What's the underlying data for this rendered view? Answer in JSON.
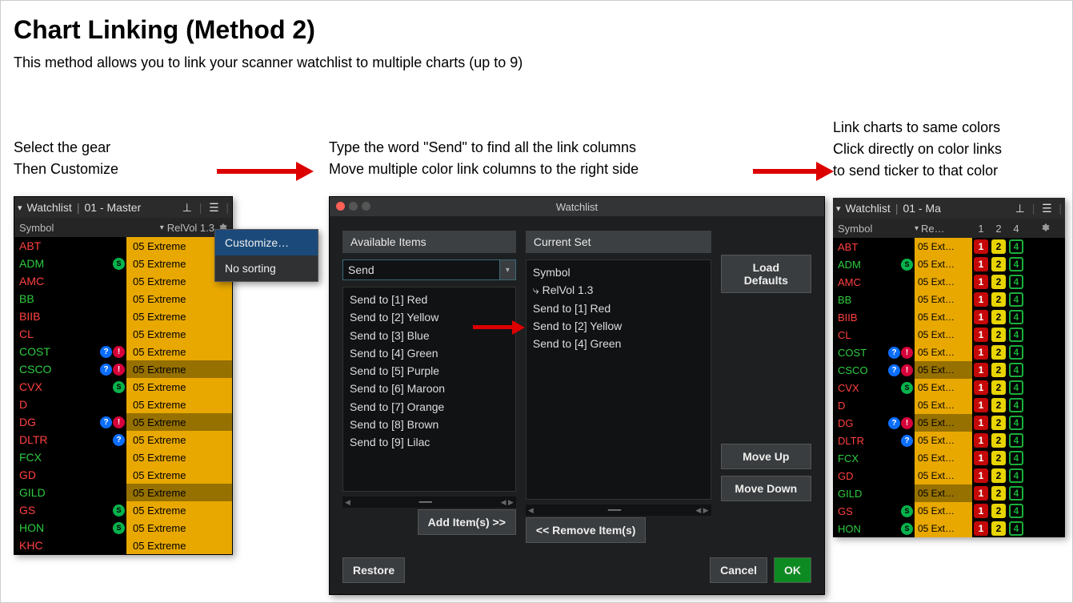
{
  "title": "Chart Linking (Method 2)",
  "subtitle": "This method allows you to link your scanner watchlist to multiple charts (up to 9)",
  "step1": {
    "caption1": "Select the gear",
    "caption2": "Then Customize",
    "titlebar_label": "Watchlist",
    "titlebar_profile": "01 - Master",
    "header_symbol": "Symbol",
    "header_relvol": "RelVol 1.3",
    "ctx_customize": "Customize…",
    "ctx_nosorting": "No sorting",
    "rows": [
      {
        "sym": "ABT",
        "c": "red",
        "vol": "05 Extreme",
        "b": true,
        "icons": []
      },
      {
        "sym": "ADM",
        "c": "green",
        "vol": "05 Extreme",
        "b": true,
        "icons": [
          "s"
        ]
      },
      {
        "sym": "AMC",
        "c": "red",
        "vol": "05 Extreme",
        "b": true,
        "icons": []
      },
      {
        "sym": "BB",
        "c": "green",
        "vol": "05 Extreme",
        "b": true,
        "icons": []
      },
      {
        "sym": "BIIB",
        "c": "red",
        "vol": "05 Extreme",
        "b": true,
        "icons": []
      },
      {
        "sym": "CL",
        "c": "red",
        "vol": "05 Extreme",
        "b": true,
        "icons": []
      },
      {
        "sym": "COST",
        "c": "green",
        "vol": "05 Extreme",
        "b": true,
        "icons": [
          "q",
          "bang"
        ]
      },
      {
        "sym": "CSCO",
        "c": "green",
        "vol": "05 Extreme",
        "b": false,
        "icons": [
          "q",
          "bang"
        ]
      },
      {
        "sym": "CVX",
        "c": "red",
        "vol": "05 Extreme",
        "b": true,
        "icons": [
          "s"
        ]
      },
      {
        "sym": "D",
        "c": "red",
        "vol": "05 Extreme",
        "b": true,
        "icons": []
      },
      {
        "sym": "DG",
        "c": "red",
        "vol": "05 Extreme",
        "b": false,
        "icons": [
          "q",
          "bang"
        ]
      },
      {
        "sym": "DLTR",
        "c": "red",
        "vol": "05 Extreme",
        "b": true,
        "icons": [
          "q"
        ]
      },
      {
        "sym": "FCX",
        "c": "green",
        "vol": "05 Extreme",
        "b": true,
        "icons": []
      },
      {
        "sym": "GD",
        "c": "red",
        "vol": "05 Extreme",
        "b": true,
        "icons": []
      },
      {
        "sym": "GILD",
        "c": "green",
        "vol": "05 Extreme",
        "b": false,
        "icons": []
      },
      {
        "sym": "GS",
        "c": "red",
        "vol": "05 Extreme",
        "b": true,
        "icons": [
          "s"
        ]
      },
      {
        "sym": "HON",
        "c": "green",
        "vol": "05 Extreme",
        "b": true,
        "icons": [
          "s"
        ]
      },
      {
        "sym": "KHC",
        "c": "red",
        "vol": "05 Extreme",
        "b": true,
        "icons": []
      }
    ]
  },
  "step2": {
    "caption1": "Type the word \"Send\" to find all the link columns",
    "caption2": "Move multiple color link columns to the right side",
    "dialog_title": "Watchlist",
    "available_title": "Available Items",
    "current_title": "Current Set",
    "search_value": "Send",
    "available": [
      "Send to [1] Red",
      "Send to [2] Yellow",
      "Send to [3] Blue",
      "Send to [4] Green",
      "Send to [5] Purple",
      "Send to [6] Maroon",
      "Send to [7] Orange",
      "Send to [8] Brown",
      "Send to [9] Lilac"
    ],
    "current": [
      "Symbol",
      "⤷ RelVol 1.3",
      "Send to [1] Red",
      "Send to [2] Yellow",
      "Send to [4] Green"
    ],
    "btn_load_defaults": "Load Defaults",
    "btn_move_up": "Move Up",
    "btn_move_down": "Move Down",
    "btn_add": "Add Item(s) >>",
    "btn_remove": "<< Remove Item(s)",
    "btn_restore": "Restore",
    "btn_cancel": "Cancel",
    "btn_ok": "OK"
  },
  "step3": {
    "caption1": "Link charts to same colors",
    "caption2": "Click directly on color links",
    "caption3": "to send ticker to that color",
    "titlebar_label": "Watchlist",
    "titlebar_profile": "01 - Ma",
    "header_symbol": "Symbol",
    "header_re": "Re…",
    "header_1": "1",
    "header_2": "2",
    "header_4": "4",
    "rows": [
      {
        "sym": "ABT",
        "c": "red",
        "vol": "05 Ext…",
        "b": true,
        "icons": []
      },
      {
        "sym": "ADM",
        "c": "green",
        "vol": "05 Ext…",
        "b": true,
        "icons": [
          "s"
        ]
      },
      {
        "sym": "AMC",
        "c": "red",
        "vol": "05 Ext…",
        "b": true,
        "icons": []
      },
      {
        "sym": "BB",
        "c": "green",
        "vol": "05 Ext…",
        "b": true,
        "icons": []
      },
      {
        "sym": "BIIB",
        "c": "red",
        "vol": "05 Ext…",
        "b": true,
        "icons": []
      },
      {
        "sym": "CL",
        "c": "red",
        "vol": "05 Ext…",
        "b": true,
        "icons": []
      },
      {
        "sym": "COST",
        "c": "green",
        "vol": "05 Ext…",
        "b": true,
        "icons": [
          "q",
          "bang"
        ]
      },
      {
        "sym": "CSCO",
        "c": "green",
        "vol": "05 Ext…",
        "b": false,
        "icons": [
          "q",
          "bang"
        ]
      },
      {
        "sym": "CVX",
        "c": "red",
        "vol": "05 Ext…",
        "b": true,
        "icons": [
          "s"
        ]
      },
      {
        "sym": "D",
        "c": "red",
        "vol": "05 Ext…",
        "b": true,
        "icons": []
      },
      {
        "sym": "DG",
        "c": "red",
        "vol": "05 Ext…",
        "b": false,
        "icons": [
          "q",
          "bang"
        ]
      },
      {
        "sym": "DLTR",
        "c": "red",
        "vol": "05 Ext…",
        "b": true,
        "icons": [
          "q"
        ]
      },
      {
        "sym": "FCX",
        "c": "green",
        "vol": "05 Ext…",
        "b": true,
        "icons": []
      },
      {
        "sym": "GD",
        "c": "red",
        "vol": "05 Ext…",
        "b": true,
        "icons": []
      },
      {
        "sym": "GILD",
        "c": "green",
        "vol": "05 Ext…",
        "b": false,
        "icons": []
      },
      {
        "sym": "GS",
        "c": "red",
        "vol": "05 Ext…",
        "b": true,
        "icons": [
          "s"
        ]
      },
      {
        "sym": "HON",
        "c": "green",
        "vol": "05 Ext…",
        "b": true,
        "icons": [
          "s"
        ]
      }
    ]
  }
}
